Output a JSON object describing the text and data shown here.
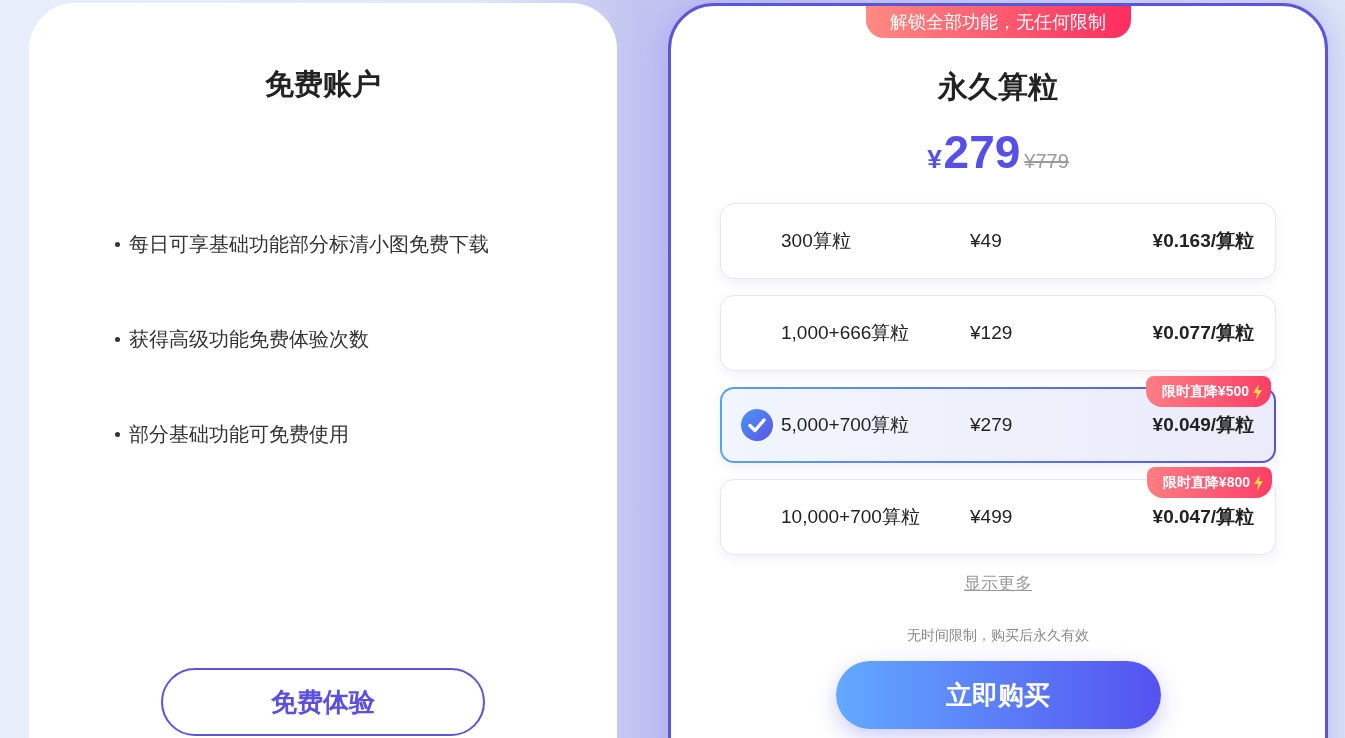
{
  "free_plan": {
    "title": "免费账户",
    "features": [
      "每日可享基础功能部分标清小图免费下载",
      "获得高级功能免费体验次数",
      "部分基础功能可免费使用"
    ],
    "button": "免费体验"
  },
  "lifetime_plan": {
    "ribbon": "解锁全部功能，无任何限制",
    "title": "永久算粒",
    "price": {
      "currency": "¥",
      "amount": "279",
      "original": "¥779"
    },
    "options": [
      {
        "credits": "300算粒",
        "price": "¥49",
        "unit_price": "¥0.163/算粒",
        "selected": false
      },
      {
        "credits": "1,000+666算粒",
        "price": "¥129",
        "unit_price": "¥0.077/算粒",
        "selected": false
      },
      {
        "credits": "5,000+700算粒",
        "price": "¥279",
        "unit_price": "¥0.049/算粒",
        "selected": true,
        "badge": "限时直降¥500"
      },
      {
        "credits": "10,000+700算粒",
        "price": "¥499",
        "unit_price": "¥0.047/算粒",
        "selected": false,
        "badge": "限时直降¥800"
      }
    ],
    "show_more": "显示更多",
    "note": "无时间限制，购买后永久有效",
    "button": "立即购买"
  }
}
